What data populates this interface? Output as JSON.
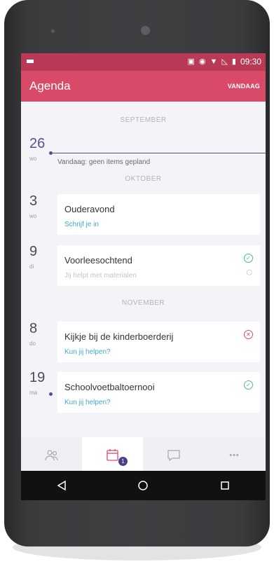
{
  "statusbar": {
    "time": "09:30",
    "icons": [
      "screen-icon",
      "sync-icon",
      "wifi-icon",
      "signal-icon",
      "battery-icon"
    ]
  },
  "appbar": {
    "title": "Agenda",
    "today_button": "VANDAAG"
  },
  "agenda": {
    "months": [
      "SEPTEMBER",
      "OKTOBER",
      "NOVEMBER"
    ],
    "today": {
      "day": "26",
      "weekday": "wo",
      "text": "Vandaag: geen items gepland"
    },
    "events": [
      {
        "day": "3",
        "weekday": "wo",
        "title": "Ouderavond",
        "subtitle": "Schrijf je in",
        "status": ""
      },
      {
        "day": "9",
        "weekday": "di",
        "title": "Voorleesochtend",
        "subtitle": "Jij helpt met materialen",
        "status": "check-icon"
      },
      {
        "day": "8",
        "weekday": "do",
        "title": "Kijkje bij de kinderboerderij",
        "subtitle": "Kun jij helpen?",
        "status": "cross-icon"
      },
      {
        "day": "19",
        "weekday": "ma",
        "title": "Schoolvoetbaltoernooi",
        "subtitle": "Kun jij helpen?",
        "status": "check-icon"
      }
    ]
  },
  "tabs": {
    "items": [
      "people-icon",
      "calendar-icon",
      "chat-icon",
      "more-icon"
    ],
    "active": "calendar-icon",
    "calendar_badge": "1",
    "more_label": "•••"
  },
  "colors": {
    "primary": "#d94a69",
    "status_bar": "#b83a56",
    "accent": "#5a4e8f",
    "link": "#3fa9d4",
    "ok": "#4db6a3"
  }
}
